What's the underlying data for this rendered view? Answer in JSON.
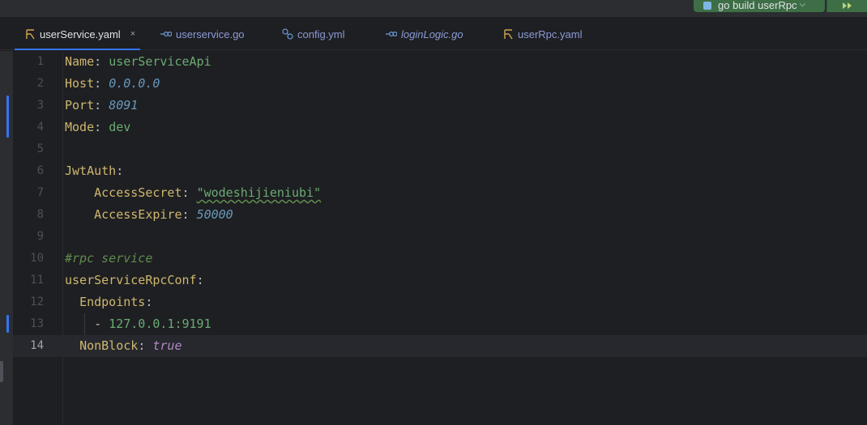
{
  "run_config": {
    "label": "go build userRpc",
    "chevron": "⌵",
    "run_icon": "run-icon",
    "color": "#3d6e46"
  },
  "tabs": [
    {
      "label": "userService.yaml",
      "icon": "yaml-file-icon",
      "active": true,
      "close": "×"
    },
    {
      "label": "userservice.go",
      "icon": "go-file-icon",
      "active": false
    },
    {
      "label": "config.yml",
      "icon": "config-file-icon",
      "active": false
    },
    {
      "label": "loginLogic.go",
      "icon": "go-file-icon",
      "active": false,
      "italic": true
    },
    {
      "label": "userRpc.yaml",
      "icon": "yaml-file-icon",
      "active": false
    }
  ],
  "editor": {
    "current_line": 14,
    "lines": [
      {
        "num": "1",
        "key": "Name",
        "sep": ": ",
        "value": "userServiceApi",
        "value_type": "string"
      },
      {
        "num": "2",
        "key": "Host",
        "sep": ": ",
        "value": "0.0.0.0",
        "value_type": "number"
      },
      {
        "num": "3",
        "key": "Port",
        "sep": ": ",
        "value": "8091",
        "value_type": "number"
      },
      {
        "num": "4",
        "key": "Mode",
        "sep": ": ",
        "value": "dev",
        "value_type": "string"
      },
      {
        "num": "5"
      },
      {
        "num": "6",
        "key": "JwtAuth",
        "sep": ":"
      },
      {
        "num": "7",
        "indent": "    ",
        "key": "AccessSecret",
        "sep": ": ",
        "value": "\"wodeshijieniubi\"",
        "value_type": "string"
      },
      {
        "num": "8",
        "indent": "    ",
        "key": "AccessExpire",
        "sep": ": ",
        "value": "50000",
        "value_type": "number"
      },
      {
        "num": "9"
      },
      {
        "num": "10",
        "comment": "#rpc service"
      },
      {
        "num": "11",
        "key": "userServiceRpcConf",
        "sep": ":"
      },
      {
        "num": "12",
        "indent": "  ",
        "key": "Endpoints",
        "sep": ":"
      },
      {
        "num": "13",
        "indent": "    ",
        "dash": "- ",
        "value": "127.0.0.1:9191",
        "value_type": "string"
      },
      {
        "num": "14",
        "indent": "  ",
        "key": "NonBlock",
        "sep": ": ",
        "value": "true",
        "value_type": "boolean"
      }
    ]
  },
  "colors": {
    "background": "#1e1f22",
    "key": "#cfb76f",
    "string": "#6aab73",
    "number": "#6897bb",
    "comment": "#5f8d4e",
    "boolean": "#b389c5",
    "accent": "#3574f0"
  }
}
